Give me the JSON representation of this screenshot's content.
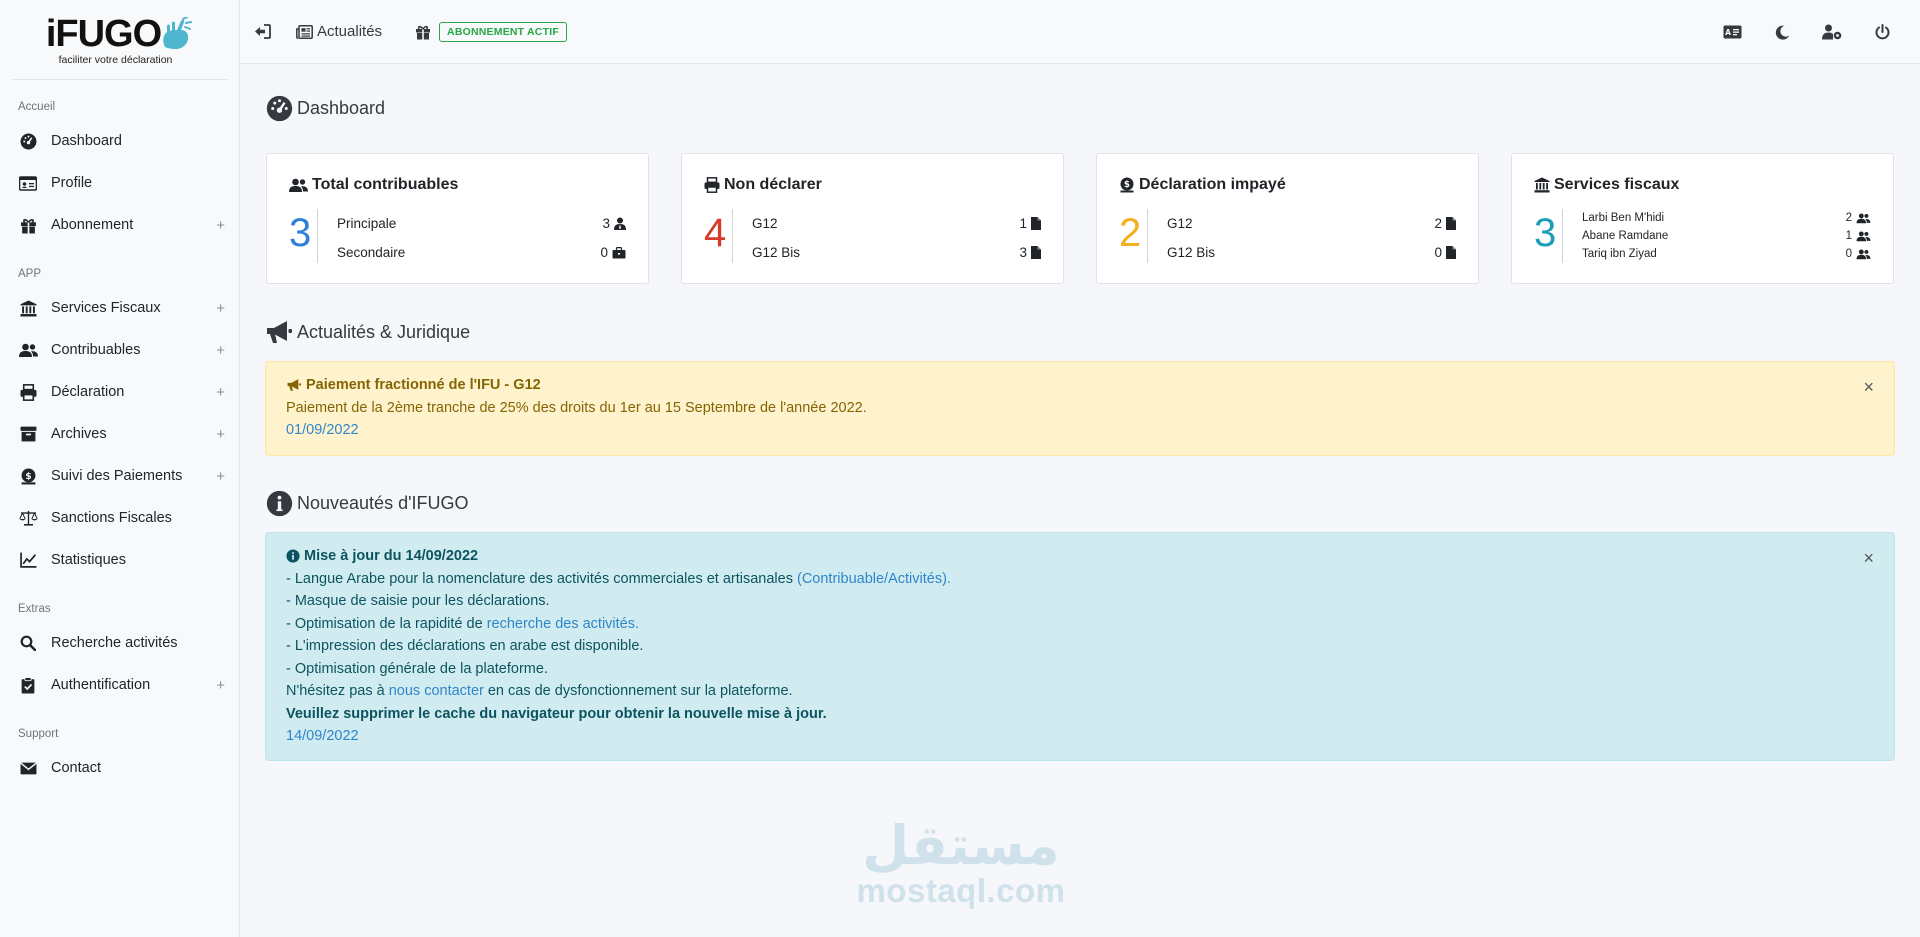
{
  "logo": {
    "name": "iFUGO",
    "tagline": "faciliter votre déclaration"
  },
  "sidebar": {
    "sections": [
      {
        "label": "Accueil",
        "items": [
          {
            "label": "Dashboard",
            "icon": "dashboard-icon",
            "expandable": false
          },
          {
            "label": "Profile",
            "icon": "id-card-icon",
            "expandable": false
          },
          {
            "label": "Abonnement",
            "icon": "gift-icon",
            "expandable": true
          }
        ]
      },
      {
        "label": "APP",
        "items": [
          {
            "label": "Services Fiscaux",
            "icon": "bank-icon",
            "expandable": true
          },
          {
            "label": "Contribuables",
            "icon": "users-icon",
            "expandable": true
          },
          {
            "label": "Déclaration",
            "icon": "print-icon",
            "expandable": true
          },
          {
            "label": "Archives",
            "icon": "archive-icon",
            "expandable": true
          },
          {
            "label": "Suivi des Paiements",
            "icon": "money-bag-icon",
            "expandable": true
          },
          {
            "label": "Sanctions Fiscales",
            "icon": "scale-icon",
            "expandable": false
          },
          {
            "label": "Statistiques",
            "icon": "chart-line-icon",
            "expandable": false
          }
        ]
      },
      {
        "label": "Extras",
        "items": [
          {
            "label": "Recherche activités",
            "icon": "search-icon",
            "expandable": false
          },
          {
            "label": "Authentification",
            "icon": "clipboard-check-icon",
            "expandable": true
          }
        ]
      },
      {
        "label": "Support",
        "items": [
          {
            "label": "Contact",
            "icon": "envelope-icon",
            "expandable": false
          }
        ]
      }
    ],
    "plus_symbol": "+"
  },
  "topbar": {
    "news_label": "Actualités",
    "subscription_badge": "ABONNEMENT ACTIF"
  },
  "dashboard": {
    "title": "Dashboard",
    "cards": [
      {
        "title": "Total contribuables",
        "total": "3",
        "color": "#2e7fd9",
        "rows": [
          {
            "label": "Principale",
            "value": "3"
          },
          {
            "label": "Secondaire",
            "value": "0"
          }
        ]
      },
      {
        "title": "Non déclarer",
        "total": "4",
        "color": "#d63a2b",
        "rows": [
          {
            "label": "G12",
            "value": "1"
          },
          {
            "label": "G12 Bis",
            "value": "3"
          }
        ]
      },
      {
        "title": "Déclaration impayé",
        "total": "2",
        "color": "#f2b01e",
        "rows": [
          {
            "label": "G12",
            "value": "2"
          },
          {
            "label": "G12 Bis",
            "value": "0"
          }
        ]
      },
      {
        "title": "Services fiscaux",
        "total": "3",
        "color": "#1e9bb8",
        "rows": [
          {
            "label": "Larbi Ben M'hidi",
            "value": "2"
          },
          {
            "label": "Abane Ramdane",
            "value": "1"
          },
          {
            "label": "Tariq ibn Ziyad",
            "value": "0"
          }
        ]
      }
    ]
  },
  "news": {
    "title": "Actualités & Juridique",
    "alert": {
      "title": "Paiement fractionné de l'IFU - G12",
      "body": "Paiement de la 2ème tranche de 25% des droits du 1er au 15 Septembre de l'année 2022.",
      "date": "01/09/2022",
      "close": "×"
    }
  },
  "updates": {
    "title": "Nouveautés d'IFUGO",
    "alert": {
      "title": "Mise à jour du 14/09/2022",
      "line1_text": "- Langue Arabe pour la nomenclature des activités commerciales et artisanales ",
      "line1_link": "(Contribuable/Activités).",
      "line2": "- Masque de saisie pour les déclarations.",
      "line3_text": "- Optimisation de la rapidité de ",
      "line3_link": "recherche des activités.",
      "line4": "- L'impression des déclarations en arabe est disponible.",
      "line5": "- Optimisation générale de la plateforme.",
      "contact_before": "N'hésitez pas à ",
      "contact_link": "nous contacter",
      "contact_after": " en cas de dysfonctionnement sur la plateforme.",
      "cache_notice": "Veuillez supprimer le cache du navigateur pour obtenir la nouvelle mise à jour.",
      "date": "14/09/2022",
      "close": "×"
    }
  },
  "watermark": {
    "arabic": "مستقل",
    "latin": "mostaql.com"
  }
}
